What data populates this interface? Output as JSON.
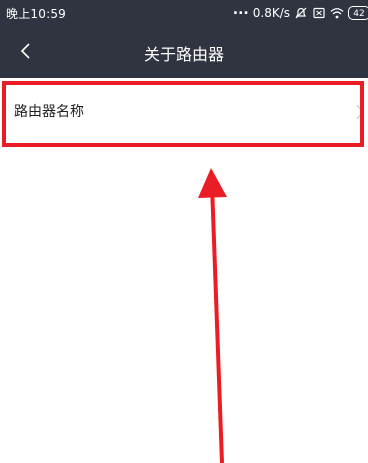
{
  "status_bar": {
    "time": "晚上10:59",
    "dots": "...",
    "speed": "0.8K/s",
    "battery": "42",
    "icons": [
      "silent-alarm-icon",
      "sim-card-icon",
      "wifi-icon",
      "battery-icon"
    ]
  },
  "header": {
    "title": "关于路由器",
    "back_icon": "chevron-left-icon"
  },
  "list": {
    "items": [
      {
        "label": "路由器名称",
        "icon": "chevron-right-icon"
      }
    ]
  },
  "colors": {
    "bar_background": "#2f3440",
    "annotation_red": "#ea1c24",
    "text_primary": "#222222",
    "background": "#ffffff"
  }
}
